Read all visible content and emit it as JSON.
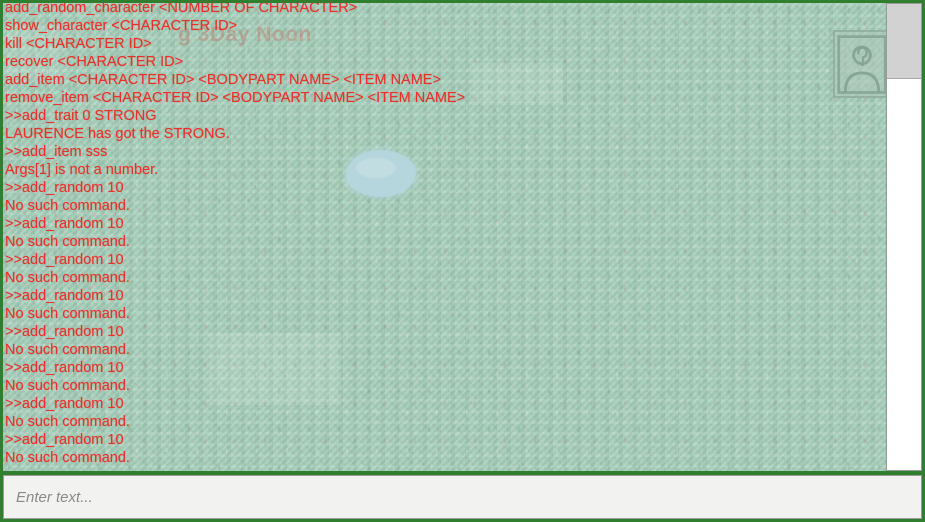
{
  "window": {
    "border_color": "#2f7f2f",
    "map_base_color": "#a6d2bd",
    "pond_color": "#b4d6dc",
    "console_text_color": "#e8312a"
  },
  "map": {
    "watermark_text": "g 3Day Noon",
    "pond_name": "pond",
    "portrait": {
      "label": "unknown-character-portrait",
      "glyph": "?"
    }
  },
  "console": {
    "lines": [
      "add_random_character <NUMBER OF CHARACTER>",
      "show_character <CHARACTER ID>",
      "kill <CHARACTER ID>",
      "recover <CHARACTER ID>",
      "add_item <CHARACTER ID> <BODYPART NAME> <ITEM NAME>",
      "remove_item <CHARACTER ID> <BODYPART NAME> <ITEM NAME>",
      ">>add_trait 0 STRONG",
      "LAURENCE has got the STRONG.",
      ">>add_item sss",
      "Args[1] is not a number.",
      ">>add_random 10",
      "No such command.",
      ">>add_random 10",
      "No such command.",
      ">>add_random 10",
      "No such command.",
      ">>add_random 10",
      "No such command.",
      ">>add_random 10",
      "No such command.",
      ">>add_random 10",
      "No such command.",
      ">>add_random 10",
      "No such command.",
      ">>add_random 10",
      "No such command."
    ]
  },
  "scrollbar": {
    "orientation": "vertical",
    "thumb_position": "top"
  },
  "input": {
    "value": "",
    "placeholder": "Enter text..."
  }
}
